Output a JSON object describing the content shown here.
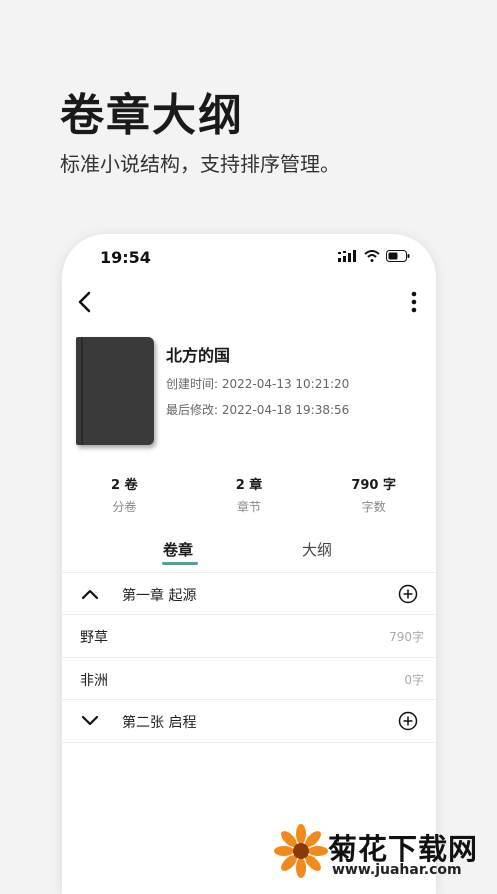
{
  "promo": {
    "title": "卷章大纲",
    "subtitle": "标准小说结构，支持排序管理。"
  },
  "status_bar": {
    "time": "19:54"
  },
  "book": {
    "title": "北方的国",
    "created": "创建时间: 2022-04-13 10:21:20",
    "modified": "最后修改: 2022-04-18 19:38:56"
  },
  "stats": [
    {
      "value": "2 卷",
      "label": "分卷"
    },
    {
      "value": "2 章",
      "label": "章节"
    },
    {
      "value": "790 字",
      "label": "字数"
    }
  ],
  "tabs": {
    "active": "卷章",
    "inactive": "大纲"
  },
  "outline": {
    "volume1": {
      "name": "第一章 起源"
    },
    "chapters": [
      {
        "name": "野草",
        "count": "790字"
      },
      {
        "name": "非洲",
        "count": "0字"
      }
    ],
    "volume2": {
      "name": "第二张 启程"
    }
  },
  "watermark": {
    "brand": "菊花下载网",
    "url": "www.juahar.com"
  },
  "colors": {
    "accent": "#4aa3a0",
    "background": "#f3f3f3"
  },
  "icons": [
    "back-icon",
    "more-icon",
    "signal-icon",
    "wifi-icon",
    "battery-icon",
    "chevron-up-icon",
    "chevron-down-icon",
    "plus-circle-icon"
  ]
}
